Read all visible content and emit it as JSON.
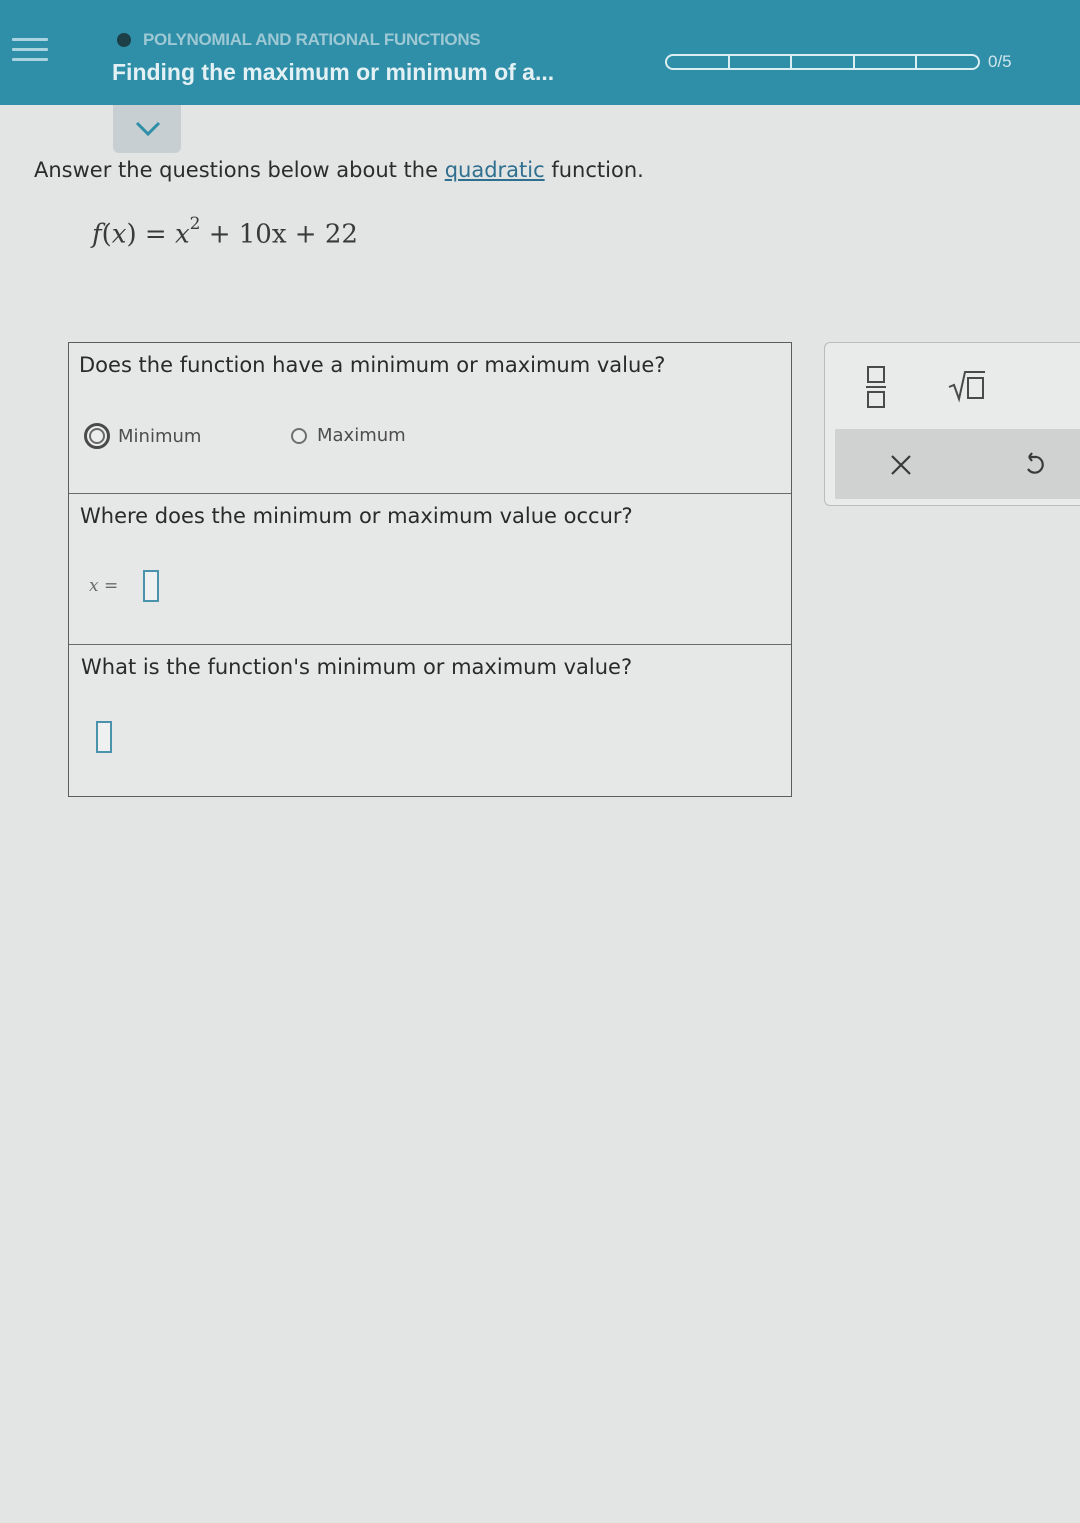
{
  "header": {
    "topic": "POLYNOMIAL AND RATIONAL FUNCTIONS",
    "title": "Finding the maximum or minimum of a...",
    "progress_text": "0/5",
    "progress": {
      "completed": 0,
      "total": 5
    }
  },
  "problem": {
    "instruction_before": "Answer the questions below about the ",
    "instruction_link": "quadratic",
    "instruction_after": " function.",
    "equation": {
      "lhs": "f",
      "var": "x",
      "middle": " = ",
      "base": "x",
      "exponent": "2",
      "rest": " + 10x + 22"
    }
  },
  "questions": [
    {
      "text": "Does the function have a minimum or maximum value?",
      "options": [
        "Minimum",
        "Maximum"
      ]
    },
    {
      "text": "Where does the minimum or maximum value occur?",
      "input_label": "x =",
      "input_value": ""
    },
    {
      "text": "What is the function's minimum or maximum value?",
      "input_value": ""
    }
  ],
  "keypad": {
    "keys": [
      "fraction-icon",
      "sqrt-icon",
      "clear-icon",
      "undo-icon"
    ]
  },
  "colors": {
    "header_bg": "#2f8fa8",
    "input_border": "#4b92ad",
    "link": "#2f6f8f"
  }
}
